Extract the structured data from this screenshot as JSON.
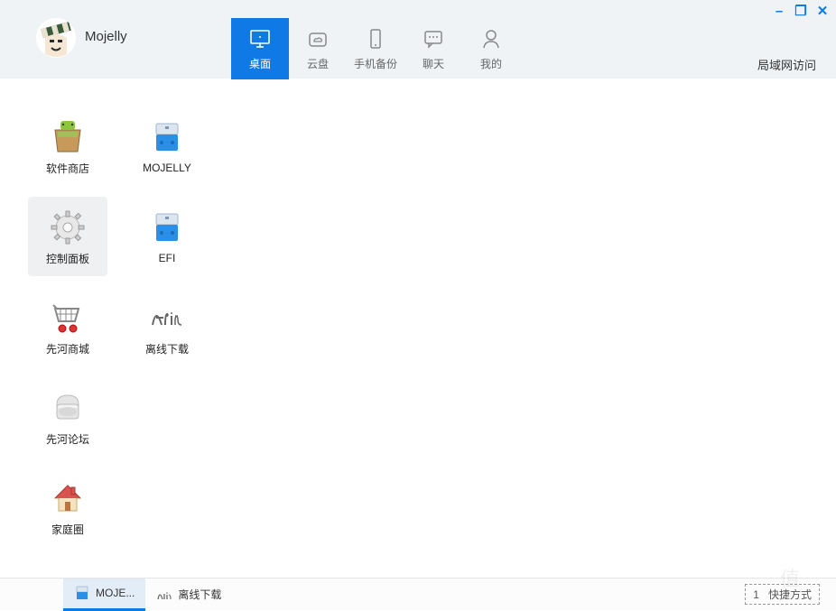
{
  "colors": {
    "accent": "#0f7ae5",
    "headerBg": "#f0f3f6",
    "selectedBg": "#eef0f2"
  },
  "user": {
    "name": "Mojelly"
  },
  "window": {
    "minimize": "–",
    "maximize": "❐",
    "close": "✕"
  },
  "nav": {
    "items": [
      {
        "id": "desktop",
        "label": "桌面",
        "active": true
      },
      {
        "id": "cloud",
        "label": "云盘",
        "active": false
      },
      {
        "id": "backup",
        "label": "手机备份",
        "active": false
      },
      {
        "id": "chat",
        "label": "聊天",
        "active": false
      },
      {
        "id": "mine",
        "label": "我的",
        "active": false
      }
    ]
  },
  "lanAccess": "局域网访问",
  "desktop": {
    "grid": [
      [
        {
          "id": "app-store",
          "label": "软件商店",
          "selected": false
        },
        {
          "id": "mojelly-drive",
          "label": "MOJELLY",
          "selected": false
        }
      ],
      [
        {
          "id": "control-panel",
          "label": "控制面板",
          "selected": true
        },
        {
          "id": "efi-drive",
          "label": "EFI",
          "selected": false
        }
      ],
      [
        {
          "id": "xianhe-mall",
          "label": "先河商城",
          "selected": false
        },
        {
          "id": "offline-dl",
          "label": "离线下载",
          "selected": false
        }
      ],
      [
        {
          "id": "xianhe-forum",
          "label": "先河论坛",
          "selected": false
        },
        null
      ],
      [
        {
          "id": "family-circle",
          "label": "家庭圈",
          "selected": false
        },
        null
      ]
    ]
  },
  "taskbar": {
    "tasks": [
      {
        "id": "mojelly-drive",
        "label": "MOJE...",
        "active": true
      },
      {
        "id": "offline-dl",
        "label": "离线下载",
        "active": false
      }
    ],
    "pageIndicator": "1",
    "rightButtonHint": "快捷方式"
  },
  "watermark": "值"
}
